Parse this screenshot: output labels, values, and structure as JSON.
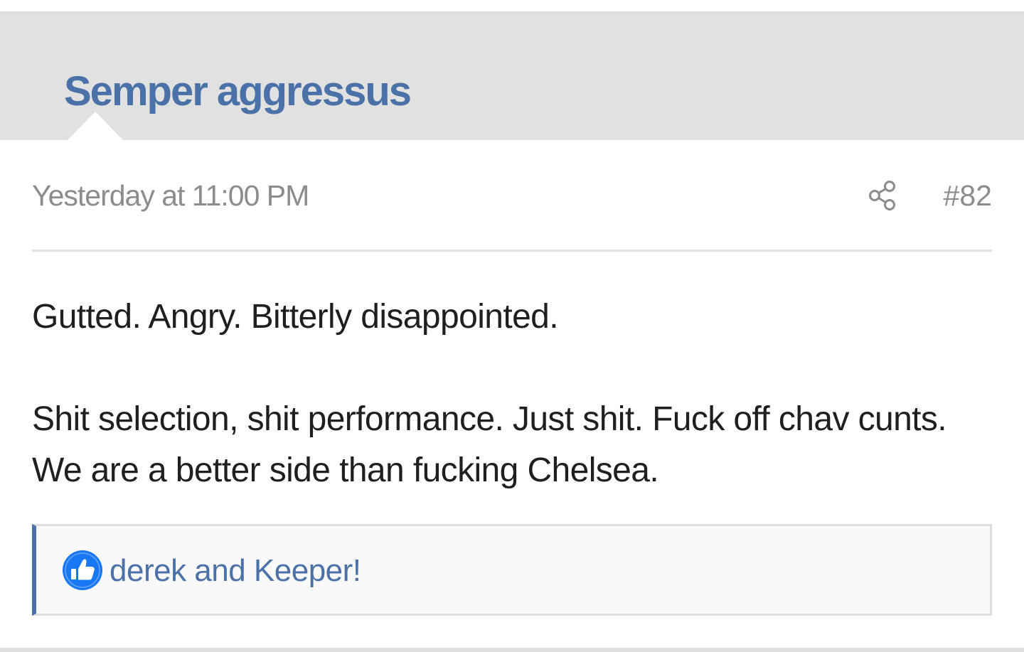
{
  "post": {
    "username": "Semper aggressus",
    "date": "Yesterday at 11:00 PM",
    "number": "#82",
    "share_icon": "share-icon",
    "message_paragraphs": [
      "Gutted. Angry. Bitterly disappointed.",
      "Shit selection, shit performance. Just shit. Fuck off chav cunts. We are a better side than fucking Chelsea."
    ],
    "reactions": {
      "icon": "thumbs-up-icon",
      "text": "derek and Keeper!"
    }
  },
  "colors": {
    "header_bg": "#e1e1e1",
    "username": "#4b72a8",
    "muted_text": "#8c8c8c",
    "body_text": "#1f1f1f",
    "like_icon": "#1877f2",
    "reaction_bar_accent": "#4b72a8"
  }
}
